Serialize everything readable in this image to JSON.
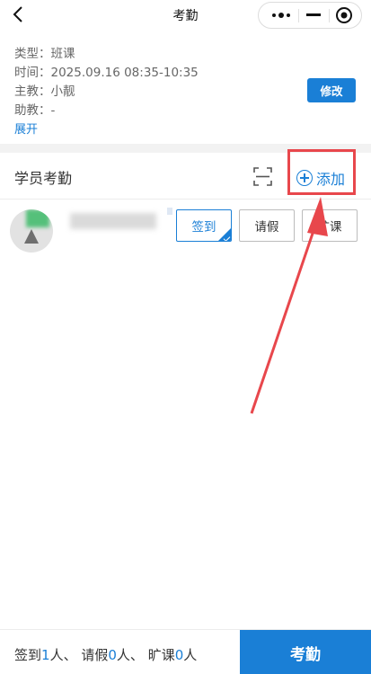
{
  "navbar": {
    "title": "考勤",
    "back_icon": "chevron-left-icon",
    "capsule": {
      "more_icon": "more-dots-icon",
      "minimize_icon": "minimize-icon",
      "close_icon": "target-circle-icon"
    }
  },
  "lesson_info": {
    "type_label": "类型：",
    "type_value": "班课",
    "time_label": "时间：",
    "time_value": "2025.09.16 08:35-10:35",
    "teacher_label": "主教：",
    "teacher_value": "小靓",
    "assistant_label": "助教：",
    "assistant_value": "-",
    "expand_label": "展开",
    "edit_button": "修改"
  },
  "attendance": {
    "title": "学员考勤",
    "scan_icon": "scan-icon",
    "add_label": "添加",
    "add_icon": "plus-circle-icon",
    "students": [
      {
        "buttons": [
          {
            "label": "签到",
            "selected": true
          },
          {
            "label": "请假",
            "selected": false
          },
          {
            "label": "旷课",
            "selected": false
          }
        ]
      }
    ]
  },
  "footer": {
    "signin_prefix": "签到",
    "signin_count": "1",
    "signin_suffix": "人、",
    "leave_prefix": "请假",
    "leave_count": "0",
    "leave_suffix": "人、",
    "absent_prefix": "旷课",
    "absent_count": "0",
    "absent_suffix": "人",
    "submit_label": "考勤"
  },
  "colors": {
    "accent": "#1a7fd6",
    "annotation": "#e8474c"
  }
}
